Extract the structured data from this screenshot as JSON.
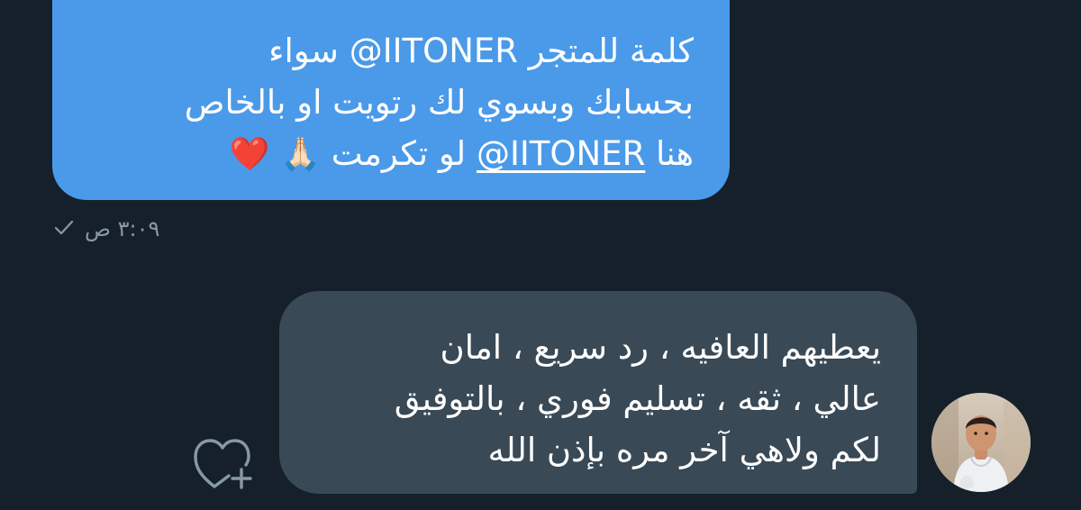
{
  "conversation": {
    "sent_message": {
      "lines": [
        [
          "كلمة للمتجر ",
          "@IITONER",
          " سواء"
        ],
        [
          "بحسابك وبسوي لك رتويت او بالخاص"
        ],
        [
          "هنا ",
          "@IITONER",
          " لو تكرمت ",
          "🙏🏻 ❤️"
        ]
      ],
      "timestamp": "٣:٠٩ ص",
      "status_icon": "check-icon"
    },
    "received_message": {
      "lines": [
        "يعطيهم العافيه ، رد سريع ، امان",
        "عالي ، ثقه ، تسليم فوري ، بالتوفيق",
        "لكم ولاهي آخر مره بإذن الله"
      ],
      "actions": {
        "like_icon": "heart-plus-icon"
      },
      "avatar": "avatar"
    }
  },
  "colors": {
    "background": "#15202b",
    "sent_bubble": "#4a9ae9",
    "received_bubble": "#394955",
    "meta_text": "#8899a6"
  }
}
